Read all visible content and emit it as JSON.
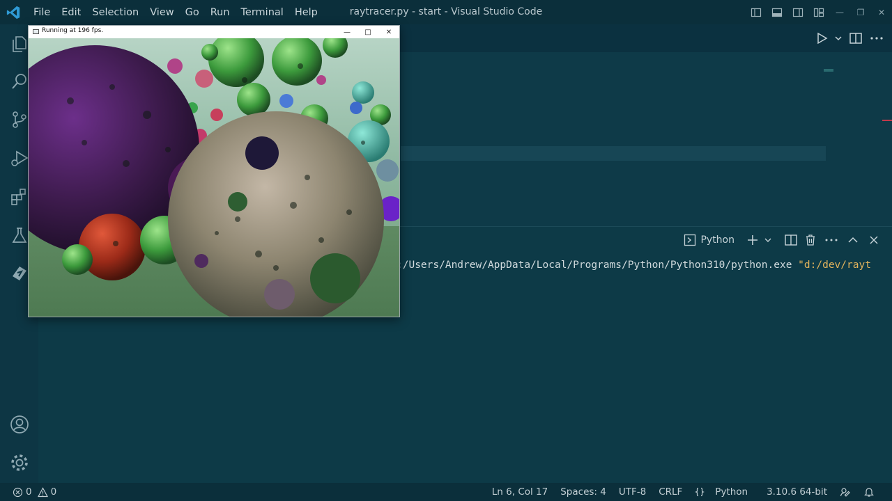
{
  "window": {
    "title": "raytracer.py - start - Visual Studio Code"
  },
  "menu": [
    "File",
    "Edit",
    "Selection",
    "View",
    "Go",
    "Run",
    "Terminal",
    "Help"
  ],
  "activity_icons": [
    "files-icon",
    "search-icon",
    "source-control-icon",
    "run-debug-icon",
    "extensions-icon",
    "testing-icon",
    "liveshare-icon"
  ],
  "activity_bottom_icons": [
    "account-icon",
    "settings-gear-icon"
  ],
  "app_window": {
    "title": "Running at 196 fps."
  },
  "panel": {
    "terminal_name": "Python",
    "command_text": ":/Users/Andrew/AppData/Local/Programs/Python/Python310/python.exe ",
    "command_arg": "\"d:/dev/rayt"
  },
  "statusbar": {
    "errors": "0",
    "warnings": "0",
    "position": "Ln 6, Col 17",
    "spaces": "Spaces: 4",
    "encoding": "UTF-8",
    "eol": "CRLF",
    "language": "Python",
    "interpreter": "3.10.6 64-bit"
  },
  "colors": {
    "editor_bg": "#0e3a48",
    "titlebar_bg": "#0b2f3b",
    "accent_blue": "#2f9bd6"
  }
}
